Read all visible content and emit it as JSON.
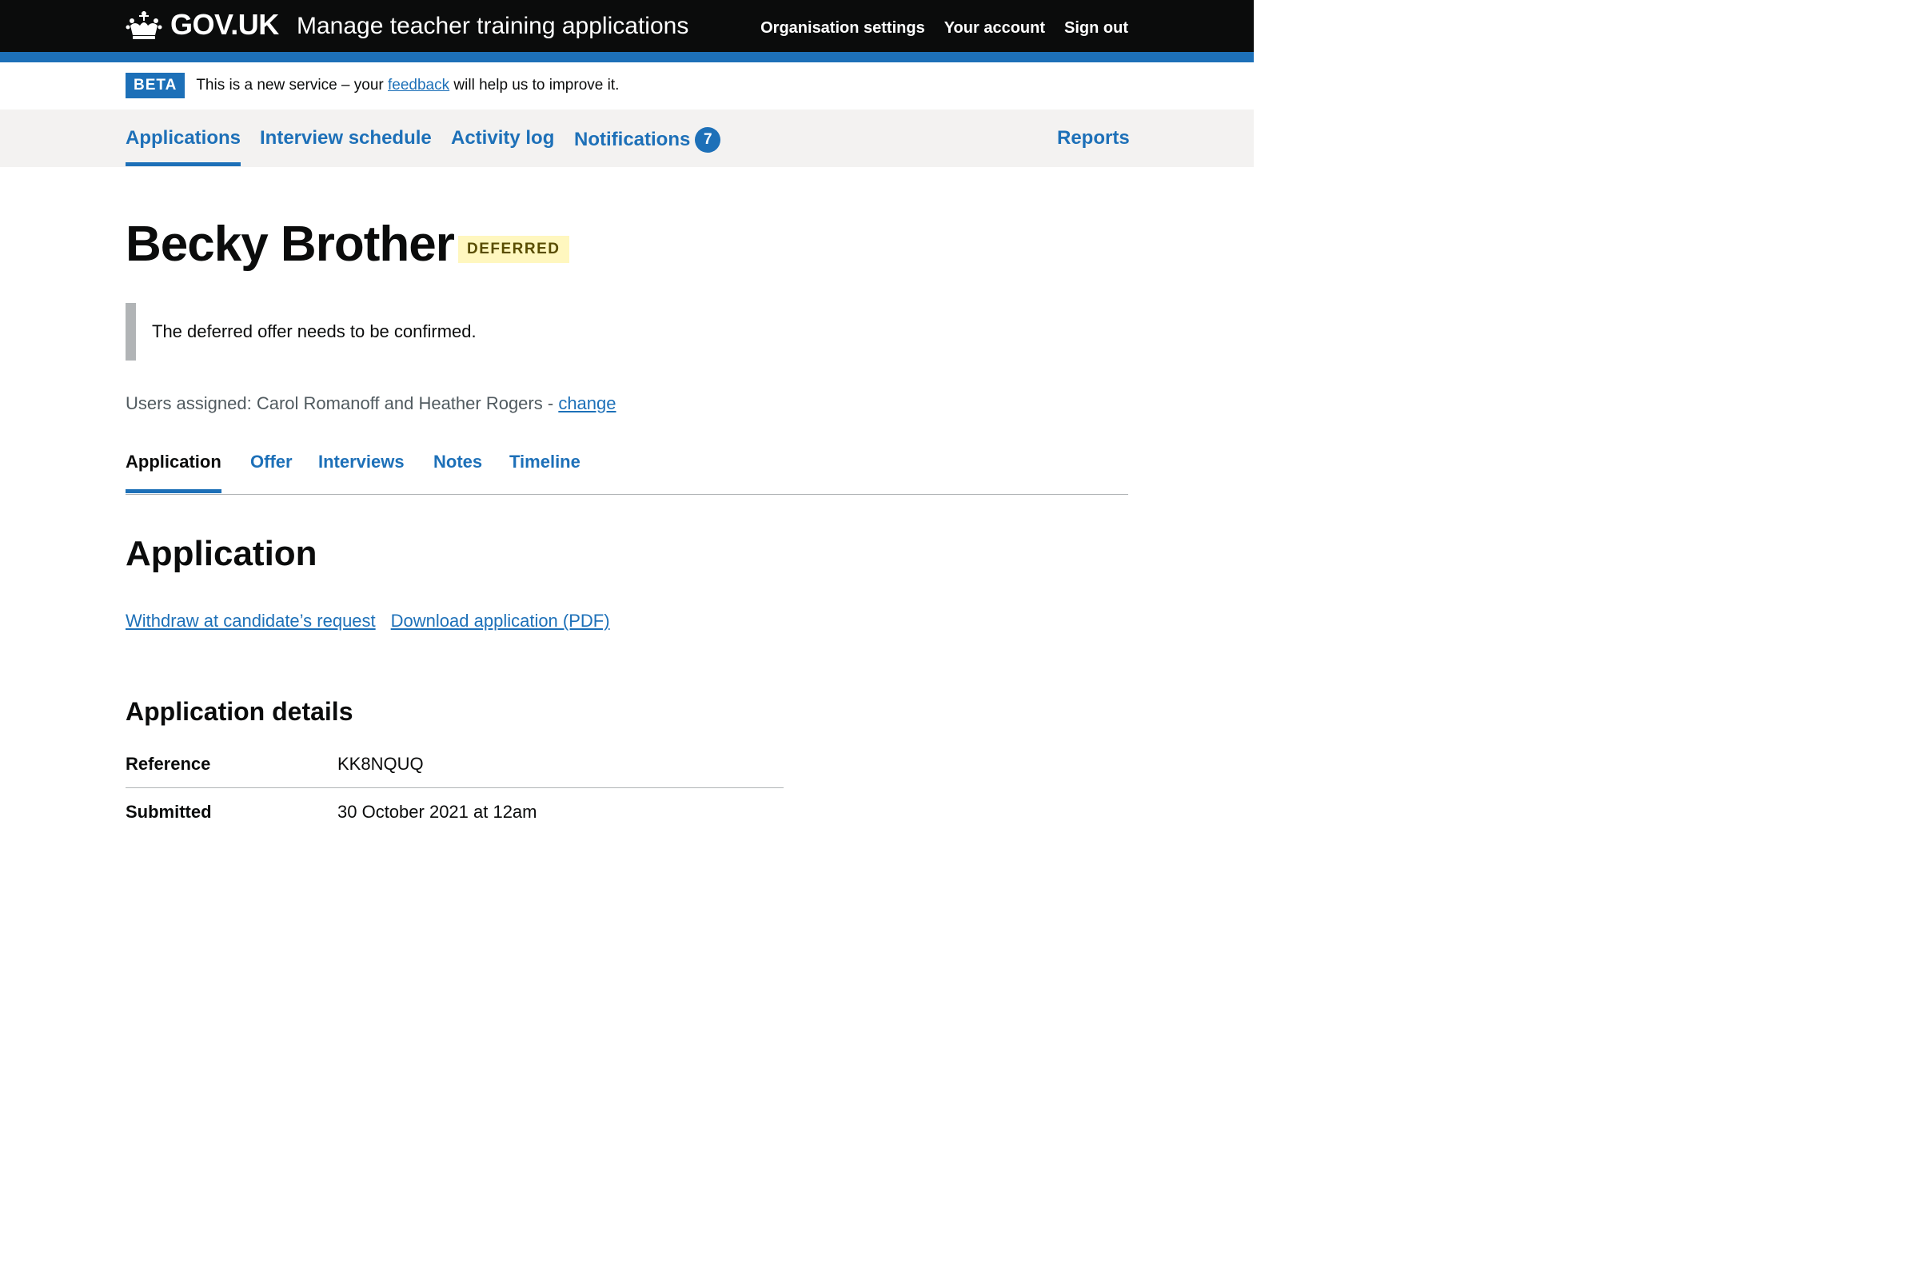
{
  "header": {
    "logo_text": "GOV.UK",
    "service_name": "Manage teacher training applications",
    "nav": [
      "Organisation settings",
      "Your account",
      "Sign out"
    ]
  },
  "beta": {
    "tag": "BETA",
    "text_before": "This is a new service – your",
    "link": "feedback",
    "text_after": "will help us to improve it."
  },
  "primary_nav": {
    "items": [
      "Applications",
      "Interview schedule",
      "Activity log",
      "Notifications"
    ],
    "notifications_count": "7",
    "reports": "Reports"
  },
  "candidate": {
    "name": "Becky Brother",
    "status": "DEFERRED",
    "notice": "The deferred offer needs to be confirmed.",
    "assigned_text": "Users assigned: Carol Romanoff and Heather Rogers -",
    "assigned_change": "change"
  },
  "tabs": [
    "Application",
    "Offer",
    "Interviews",
    "Notes",
    "Timeline"
  ],
  "application": {
    "title": "Application",
    "actions": [
      "Withdraw at candidate’s request",
      "Download application (PDF)"
    ],
    "details_title": "Application details",
    "rows": [
      {
        "key": "Reference",
        "value": "KK8NQUQ"
      },
      {
        "key": "Submitted",
        "value": "30 October 2021 at 12am"
      }
    ]
  },
  "colors": {
    "brand": "#1d70b8",
    "header": "#0b0c0c",
    "status_bg": "#fff7bf"
  }
}
